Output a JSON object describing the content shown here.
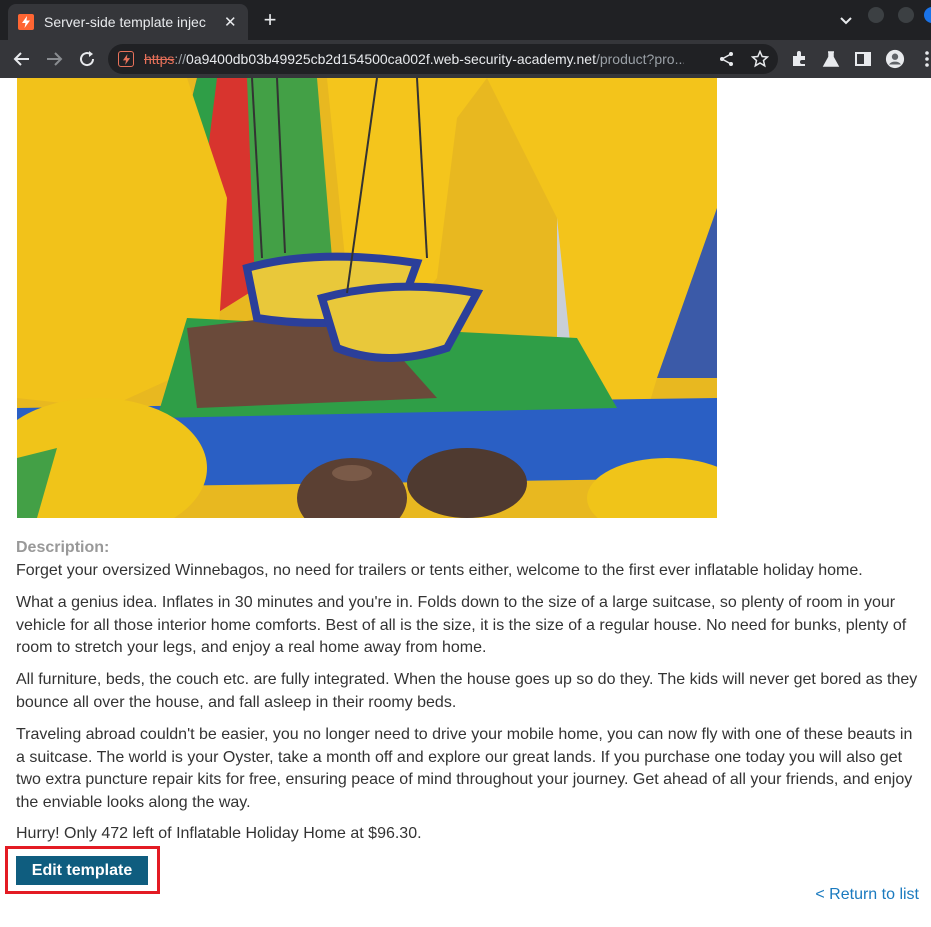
{
  "browser": {
    "tab_title": "Server-side template injec",
    "url": {
      "scheme": "https",
      "separator": "://",
      "host": "0a9400db03b49925cb2d154500ca002f.web-security-academy.net",
      "path": "/product?pro..."
    },
    "icons": [
      "lab-favicon",
      "close-icon",
      "new-tab-icon",
      "tab-search-icon",
      "back-arrow-icon",
      "forward-arrow-icon",
      "reload-icon",
      "share-icon",
      "star-icon",
      "extensions-icon",
      "labs-flask-icon",
      "side-panel-icon",
      "profile-avatar-icon",
      "menu-icon"
    ]
  },
  "product": {
    "description_label": "Description:",
    "paragraphs": [
      "Forget your oversized Winnebagos, no need for trailers or tents either, welcome to the first ever inflatable holiday home.",
      "What a genius idea. Inflates in 30 minutes and you're in. Folds down to the size of a large suitcase, so plenty of room in your vehicle for all those interior home comforts. Best of all is the size, it is the size of a regular house. No need for bunks, plenty of room to stretch your legs, and enjoy a real home away from home.",
      "All furniture, beds, the couch etc. are fully integrated. When the house goes up so do they. The kids will never get bored as they bounce all over the house, and fall asleep in their roomy beds.",
      "Traveling abroad couldn't be easier, you no longer need to drive your mobile home, you can now fly with one of these beauts in a suitcase. The world is your Oyster, take a month off and explore our great lands. If you purchase one today you will also get two extra puncture repair kits for free, ensuring peace of mind throughout your journey. Get ahead of all your friends, and enjoy the enviable looks along the way."
    ],
    "stock_message": "Hurry! Only 472 left of Inflatable Holiday Home at $96.30.",
    "edit_button": "Edit template",
    "return_link": "< Return to list"
  },
  "colors": {
    "button_bg": "#0f5d7f",
    "highlight_border": "#e31b23",
    "link": "#1a7abf",
    "label_grey": "#999999"
  }
}
